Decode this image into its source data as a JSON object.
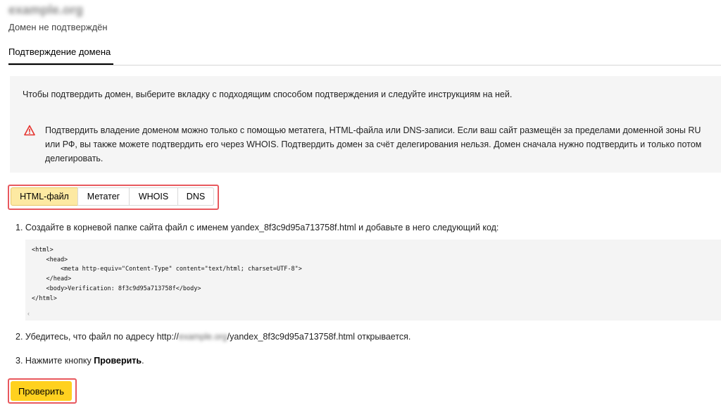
{
  "header": {
    "domain": "example.org",
    "status": "Домен не подтверждён"
  },
  "tabs": [
    {
      "label": "Подтверждение домена",
      "active": true
    }
  ],
  "info": {
    "intro": "Чтобы подтвердить домен, выберите вкладку с подходящим способом подтверждения и следуйте инструкциям на ней.",
    "warning_icon": "warning-triangle-icon",
    "warning": "Подтвердить владение доменом можно только с помощью метатега, HTML-файла или DNS-записи. Если ваш сайт размещён за пределами доменной зоны RU или РФ, вы также можете подтвердить его через WHOIS. Подтвердить домен за счёт делегирования нельзя. Домен сначала нужно подтвердить и только потом делегировать."
  },
  "methods": [
    {
      "label": "HTML-файл",
      "active": true
    },
    {
      "label": "Метатег",
      "active": false
    },
    {
      "label": "WHOIS",
      "active": false
    },
    {
      "label": "DNS",
      "active": false
    }
  ],
  "steps": {
    "step1": "1. Создайте в корневой папке сайта файл с именем yandex_8f3c9d95a713758f.html и добавьте в него следующий код:",
    "code_lines": [
      "<html>",
      "    <head>",
      "        <meta http-equiv=\"Content-Type\" content=\"text/html; charset=UTF-8\">",
      "    </head>",
      "    <body>Verification: 8f3c9d95a713758f</body>",
      "</html>"
    ],
    "scroll_arrow": "‹",
    "step2_prefix": "2. Убедитесь, что файл по адресу http://",
    "step2_domain": "example.org",
    "step2_suffix": "/yandex_8f3c9d95a713758f.html открывается.",
    "step3_prefix": "3. Нажмите кнопку ",
    "step3_bold": "Проверить",
    "step3_suffix": "."
  },
  "actions": {
    "check_label": "Проверить"
  },
  "colors": {
    "accent_yellow": "#ffd11f",
    "active_tab_bg": "#fde9a2",
    "highlight_red": "#e8595e",
    "warning_red": "#e5322d"
  }
}
